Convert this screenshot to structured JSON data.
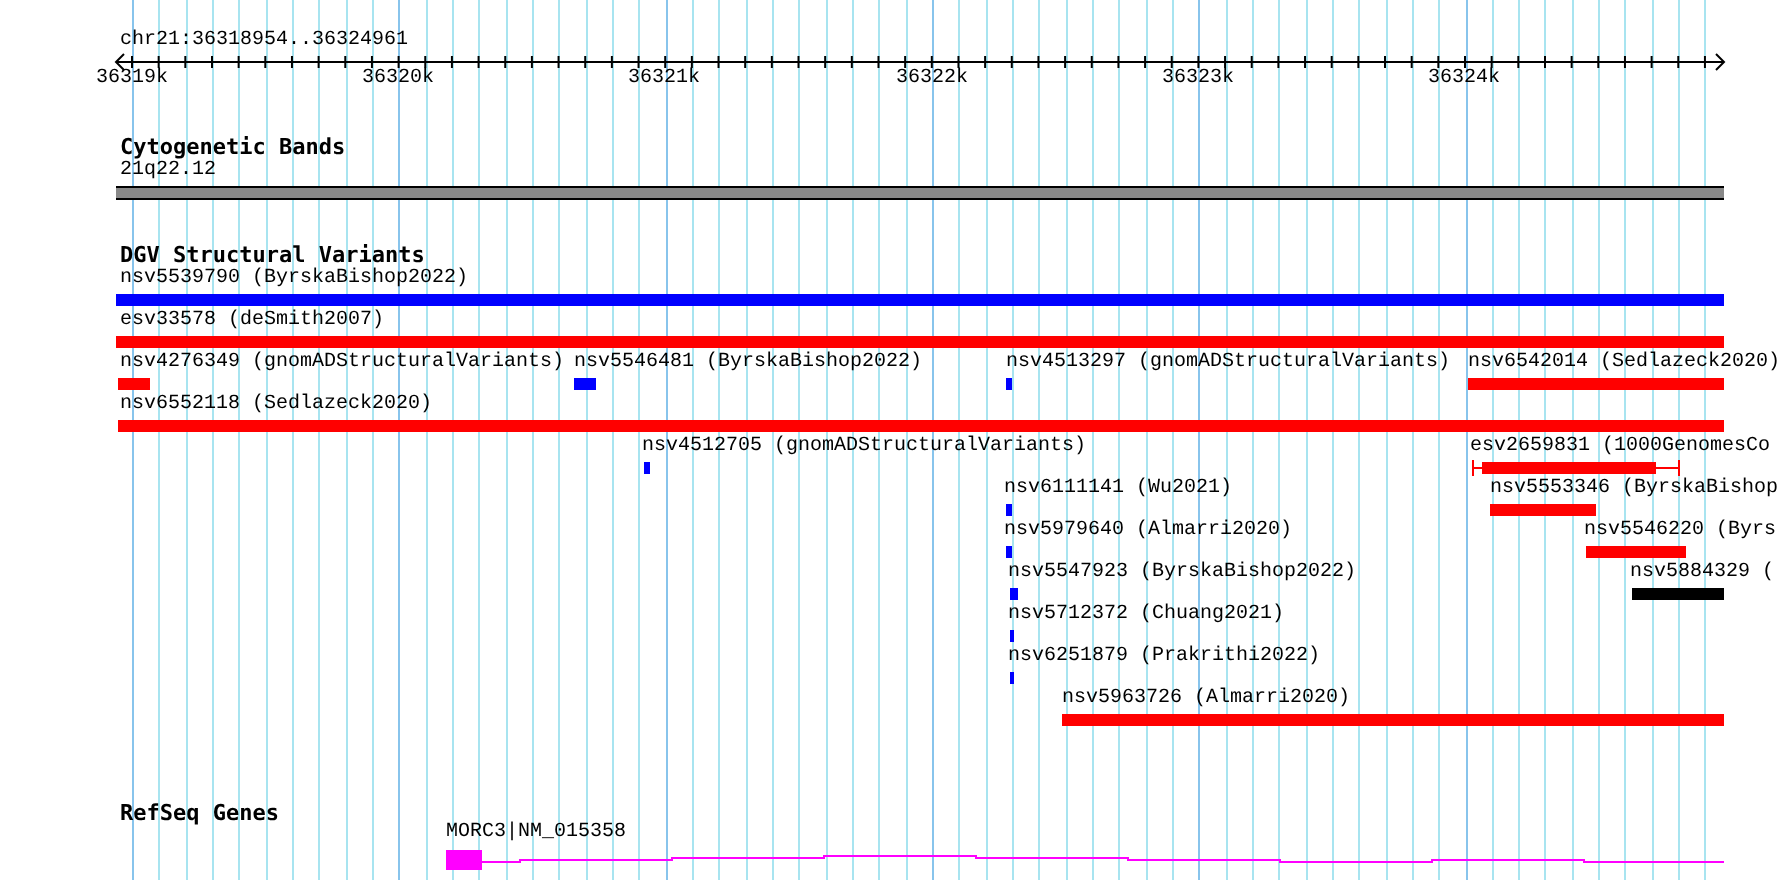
{
  "ruler": {
    "location": "chr21:36318954..36324961",
    "ticks": [
      "36319k",
      "36320k",
      "36321k",
      "36322k",
      "36323k",
      "36324k"
    ]
  },
  "tracks": [
    {
      "kind": "cytoband",
      "title": "Cytogenetic Bands",
      "bands": [
        {
          "label": "21q22.12"
        }
      ]
    },
    {
      "kind": "variants",
      "title": "DGV Structural Variants",
      "features": [
        {
          "label": "nsv5539790 (ByrskaBishop2022)",
          "color": "#0000ff",
          "kind": "bar"
        },
        {
          "label": "esv33578 (deSmith2007)",
          "color": "#ff0000",
          "kind": "bar"
        },
        {
          "label": "nsv4276349 (gnomADStructuralVariants)",
          "color": "#ff0000",
          "kind": "bar"
        },
        {
          "label": "nsv5546481 (ByrskaBishop2022)",
          "color": "#0000ff",
          "kind": "bar"
        },
        {
          "label": "nsv4513297 (gnomADStructuralVariants)",
          "color": "#0000ff",
          "kind": "bar"
        },
        {
          "label": "nsv6542014 (Sedlazeck2020)",
          "color": "#ff0000",
          "kind": "bar"
        },
        {
          "label": "nsv6552118 (Sedlazeck2020)",
          "color": "#ff0000",
          "kind": "bar"
        },
        {
          "label": "nsv4512705 (gnomADStructuralVariants)",
          "color": "#0000ff",
          "kind": "bar"
        },
        {
          "label": "esv2659831 (1000GenomesCo",
          "color": "#ff0000",
          "kind": "whisker"
        },
        {
          "label": "nsv6111141 (Wu2021)",
          "color": "#0000ff",
          "kind": "bar"
        },
        {
          "label": "nsv5553346 (ByrskaBishop",
          "color": "#ff0000",
          "kind": "bar"
        },
        {
          "label": "nsv5979640 (Almarri2020)",
          "color": "#0000ff",
          "kind": "bar"
        },
        {
          "label": "nsv5546220 (Byrs",
          "color": "#ff0000",
          "kind": "bar"
        },
        {
          "label": "nsv5547923 (ByrskaBishop2022)",
          "color": "#0000ff",
          "kind": "bar"
        },
        {
          "label": "nsv5884329 (",
          "color": "#000000",
          "kind": "bar"
        },
        {
          "label": "nsv5712372 (Chuang2021)",
          "color": "#0000ff",
          "kind": "bar"
        },
        {
          "label": "nsv6251879 (Prakrithi2022)",
          "color": "#0000ff",
          "kind": "bar"
        },
        {
          "label": "nsv5963726 (Almarri2020)",
          "color": "#ff0000",
          "kind": "bar"
        }
      ]
    },
    {
      "kind": "genes",
      "title": "RefSeq Genes",
      "genes": [
        {
          "label": "MORC3|NM_015358"
        }
      ]
    }
  ]
}
